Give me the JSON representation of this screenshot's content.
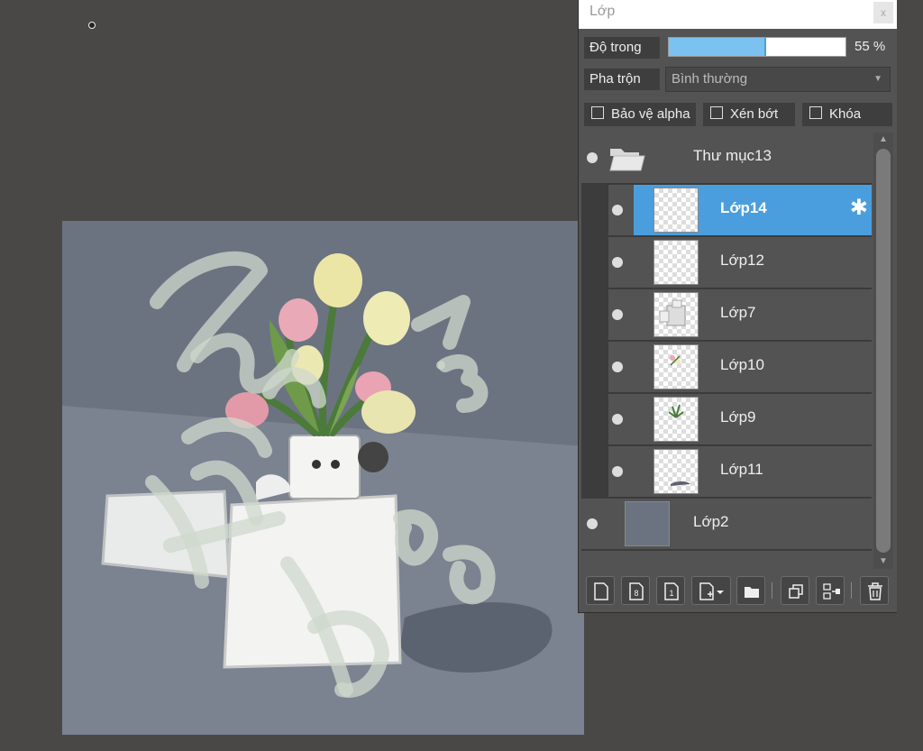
{
  "panel": {
    "title": "Lớp",
    "close_label": "x",
    "opacity_label": "Độ trong",
    "opacity_value": "55 %",
    "opacity_percent": 55,
    "blend_label": "Pha trộn",
    "blend_value": "Bình thường",
    "checks": {
      "protect_alpha": "Bảo vệ alpha",
      "clipping": "Xén bớt",
      "lock": "Khóa"
    }
  },
  "layers": [
    {
      "name": "Thư mục13",
      "type": "folder"
    },
    {
      "name": "Lớp14",
      "type": "layer",
      "selected": true
    },
    {
      "name": "Lớp12",
      "type": "layer"
    },
    {
      "name": "Lớp7",
      "type": "layer"
    },
    {
      "name": "Lớp10",
      "type": "layer"
    },
    {
      "name": "Lớp9",
      "type": "layer"
    },
    {
      "name": "Lớp11",
      "type": "layer"
    },
    {
      "name": "Lớp2",
      "type": "layer"
    }
  ],
  "toolbar_icons": [
    "new-layer-icon",
    "new-8bit-layer-icon",
    "new-1bit-layer-icon",
    "add-layer-dropdown-icon",
    "new-folder-icon",
    "duplicate-layer-icon",
    "merge-layer-icon",
    "delete-layer-icon"
  ],
  "colors": {
    "accent": "#4a9ede",
    "canvas_bg": "#6b7380",
    "panel_bg": "#535353"
  }
}
